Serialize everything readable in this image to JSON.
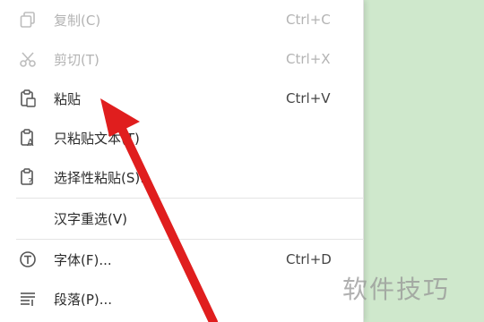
{
  "menu": {
    "items": [
      {
        "icon": "copy-icon",
        "label": "复制(C)",
        "shortcut": "Ctrl+C",
        "disabled": true
      },
      {
        "icon": "scissors-icon",
        "label": "剪切(T)",
        "shortcut": "Ctrl+X",
        "disabled": true
      },
      {
        "icon": "paste-icon",
        "label": "粘贴",
        "shortcut": "Ctrl+V",
        "disabled": false
      },
      {
        "icon": "paste-text-only-icon",
        "label": "只粘贴文本(T)",
        "shortcut": "",
        "disabled": false
      },
      {
        "icon": "paste-special-icon",
        "label": "选择性粘贴(S)...",
        "shortcut": "",
        "disabled": false
      },
      {
        "icon": "",
        "label": "汉字重选(V)",
        "shortcut": "",
        "disabled": false
      },
      {
        "icon": "font-icon",
        "label": "字体(F)...",
        "shortcut": "Ctrl+D",
        "disabled": false
      },
      {
        "icon": "paragraph-icon",
        "label": "段落(P)...",
        "shortcut": "",
        "disabled": false
      }
    ]
  },
  "watermark": "软件技巧",
  "colors": {
    "background": "#cfe8cc",
    "disabled_text": "#b3b3b3",
    "arrow": "#e01e1e"
  }
}
